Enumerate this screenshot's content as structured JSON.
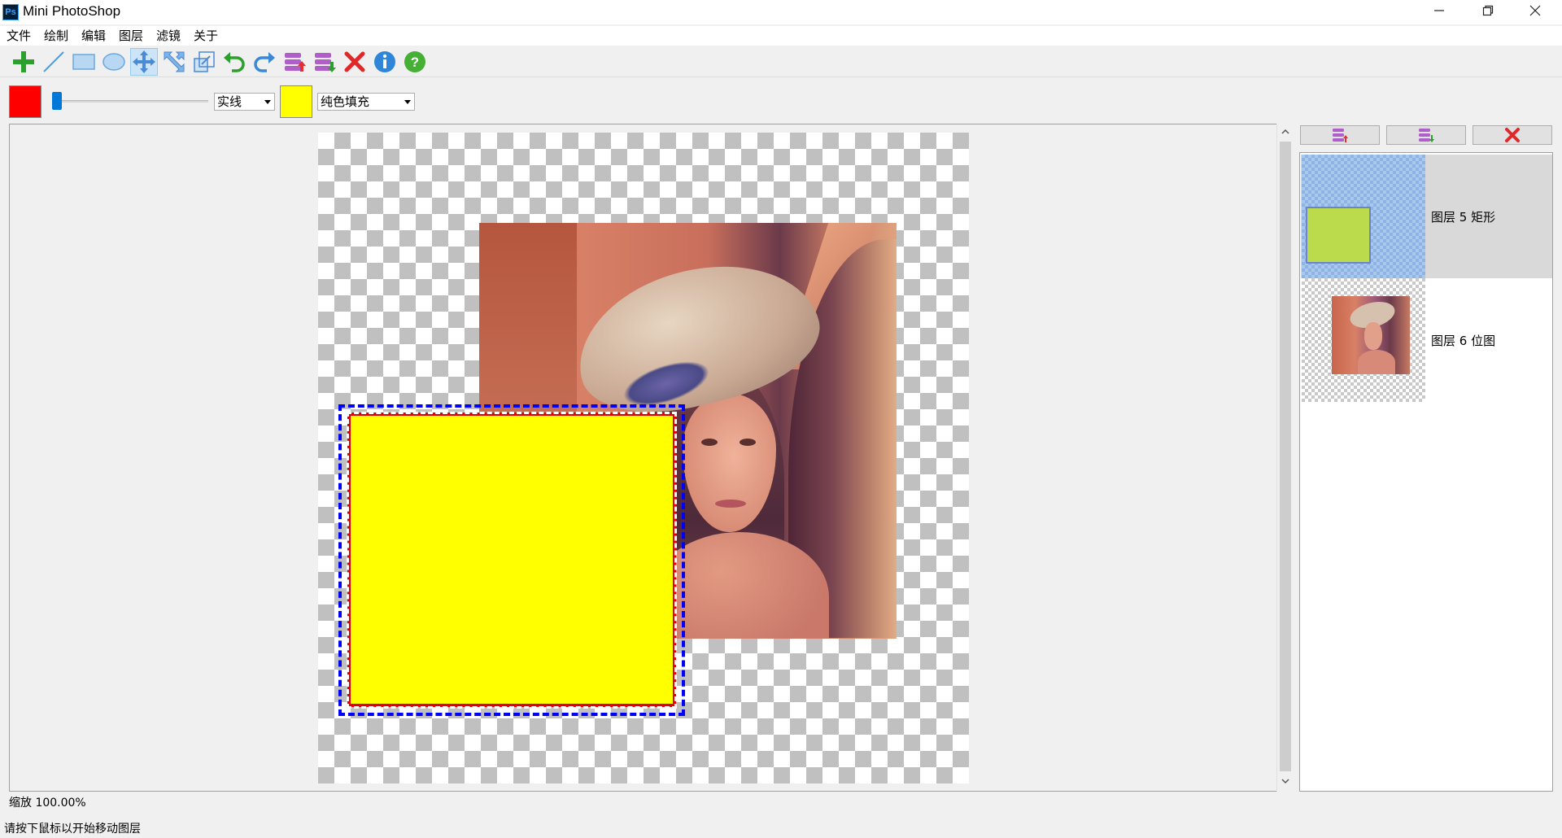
{
  "window": {
    "title": "Mini PhotoShop",
    "app_icon": "Ps"
  },
  "menu": [
    "文件",
    "绘制",
    "编辑",
    "图层",
    "滤镜",
    "关于"
  ],
  "toolbar": {
    "tools": [
      {
        "name": "add-icon",
        "active": false
      },
      {
        "name": "line-icon",
        "active": false
      },
      {
        "name": "rectangle-icon",
        "active": false
      },
      {
        "name": "ellipse-icon",
        "active": false
      },
      {
        "name": "move-icon",
        "active": true
      },
      {
        "name": "rotate-icon",
        "active": false
      },
      {
        "name": "scale-icon",
        "active": false
      },
      {
        "name": "undo-icon",
        "active": false
      },
      {
        "name": "redo-icon",
        "active": false
      },
      {
        "name": "layer-up-icon",
        "active": false
      },
      {
        "name": "layer-down-icon",
        "active": false
      },
      {
        "name": "delete-icon",
        "active": false
      },
      {
        "name": "info-icon",
        "active": false
      },
      {
        "name": "help-icon",
        "active": false
      }
    ]
  },
  "properties": {
    "stroke_color": "#ff0000",
    "fill_color": "#ffff00",
    "line_width_fraction": 0.02,
    "line_style": "实线",
    "fill_style": "纯色填充"
  },
  "canvas": {
    "selection_color": "#0000ff",
    "shape_fill": "#ffff00",
    "shape_stroke": "#e00000"
  },
  "layers": {
    "buttons": [
      "layer-up-icon",
      "layer-down-icon",
      "delete-icon"
    ],
    "items": [
      {
        "label": "图层 5 矩形",
        "selected": true
      },
      {
        "label": "图层 6 位图",
        "selected": false
      }
    ]
  },
  "status": {
    "zoom": "缩放 100.00%",
    "message": "请按下鼠标以开始移动图层"
  }
}
